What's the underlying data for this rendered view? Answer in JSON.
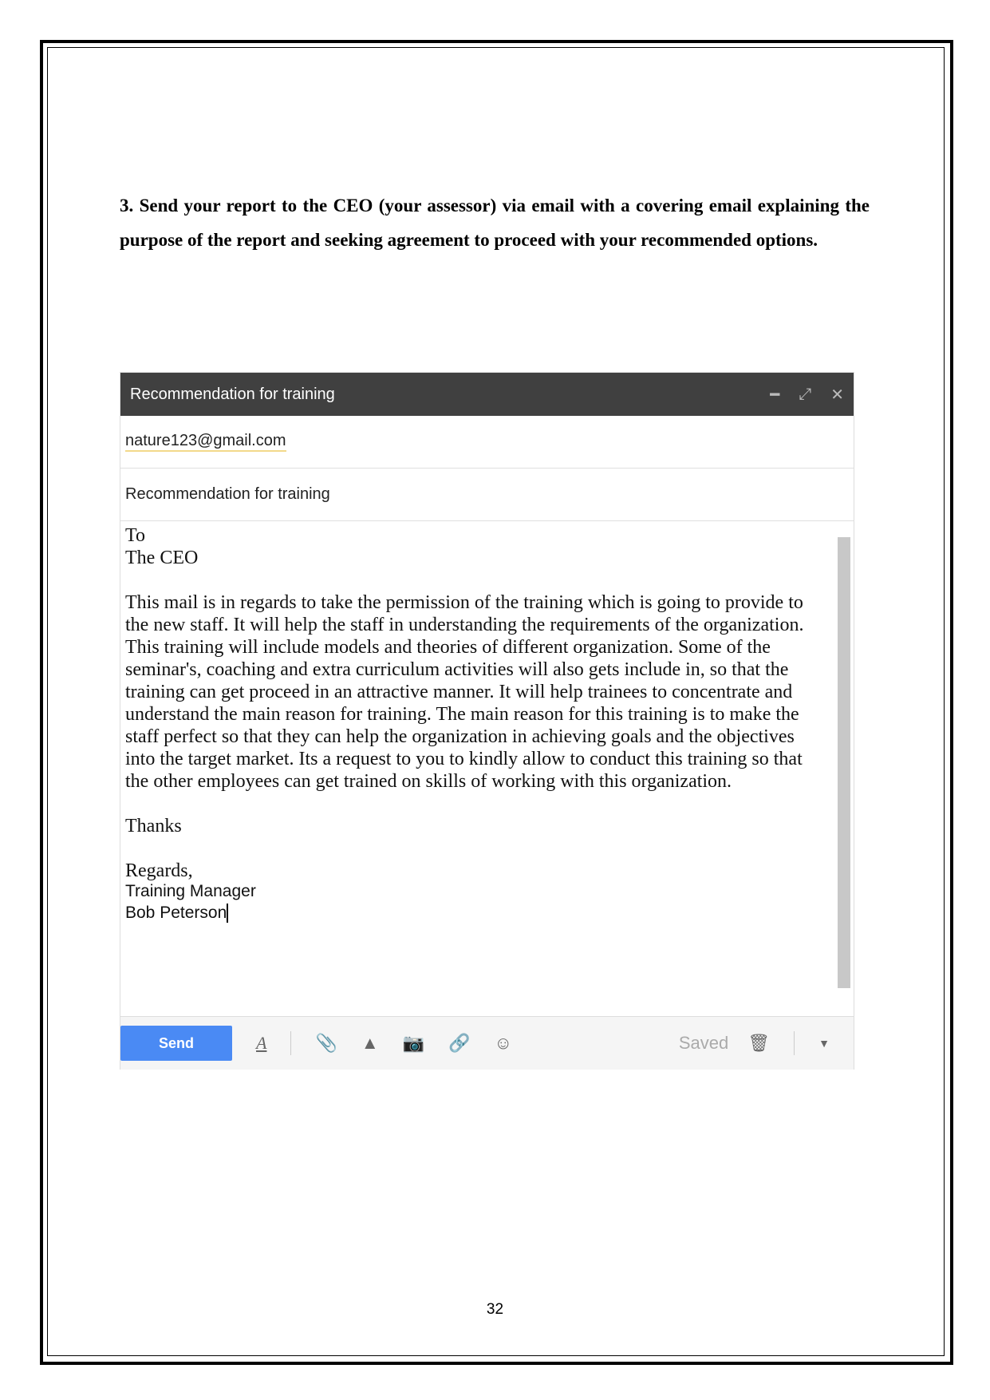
{
  "task_text": "3. Send your report to the CEO (your assessor) via email with a covering email explaining the purpose of the report and seeking agreement to proceed with your recommended options.",
  "email": {
    "window_title": "Recommendation for training",
    "to": "nature123@gmail.com",
    "subject": "Recommendation for training",
    "body": {
      "salutation_1": "To",
      "salutation_2": "The CEO",
      "paragraph": "This mail is in regards to take the permission of the training which is going to provide to the new staff. It will help the staff in understanding the requirements of the organization. This training will include models and theories of different organization. Some of the seminar's, coaching and extra curriculum activities will also gets include in, so that the training can get proceed in an attractive manner. It will help trainees to concentrate and understand the main reason for training. The main reason for this training is to make the staff perfect so that they can help the organization in achieving goals and the objectives into the target market. Its a request to you to kindly allow to conduct this training so that the other employees can get trained on skills of working with this organization.",
      "thanks": "Thanks",
      "regards": "Regards,",
      "role": "Training Manager",
      "name": "Bob Peterson"
    },
    "toolbar": {
      "send_label": "Send",
      "status": "Saved"
    },
    "send_color": "#4a8af4"
  },
  "page_number": "32"
}
